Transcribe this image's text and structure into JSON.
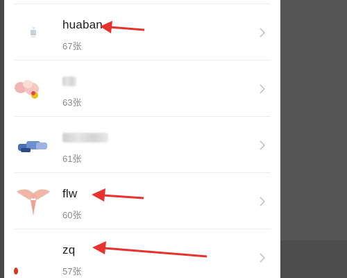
{
  "albums": [
    {
      "name": "huaban",
      "count": "67张",
      "name_visible": true
    },
    {
      "name": "",
      "count": "63张",
      "name_visible": false
    },
    {
      "name": "",
      "count": "61张",
      "name_visible": false
    },
    {
      "name": "flw",
      "count": "60张",
      "name_visible": true
    },
    {
      "name": "zq",
      "count": "57张",
      "name_visible": true
    }
  ],
  "colors": {
    "annotation_arrow": "#e8322e",
    "name_text": "#1e1e1e",
    "count_text": "#8a8a8a"
  },
  "icons": {
    "row_chevron": "chevron-right-icon"
  }
}
